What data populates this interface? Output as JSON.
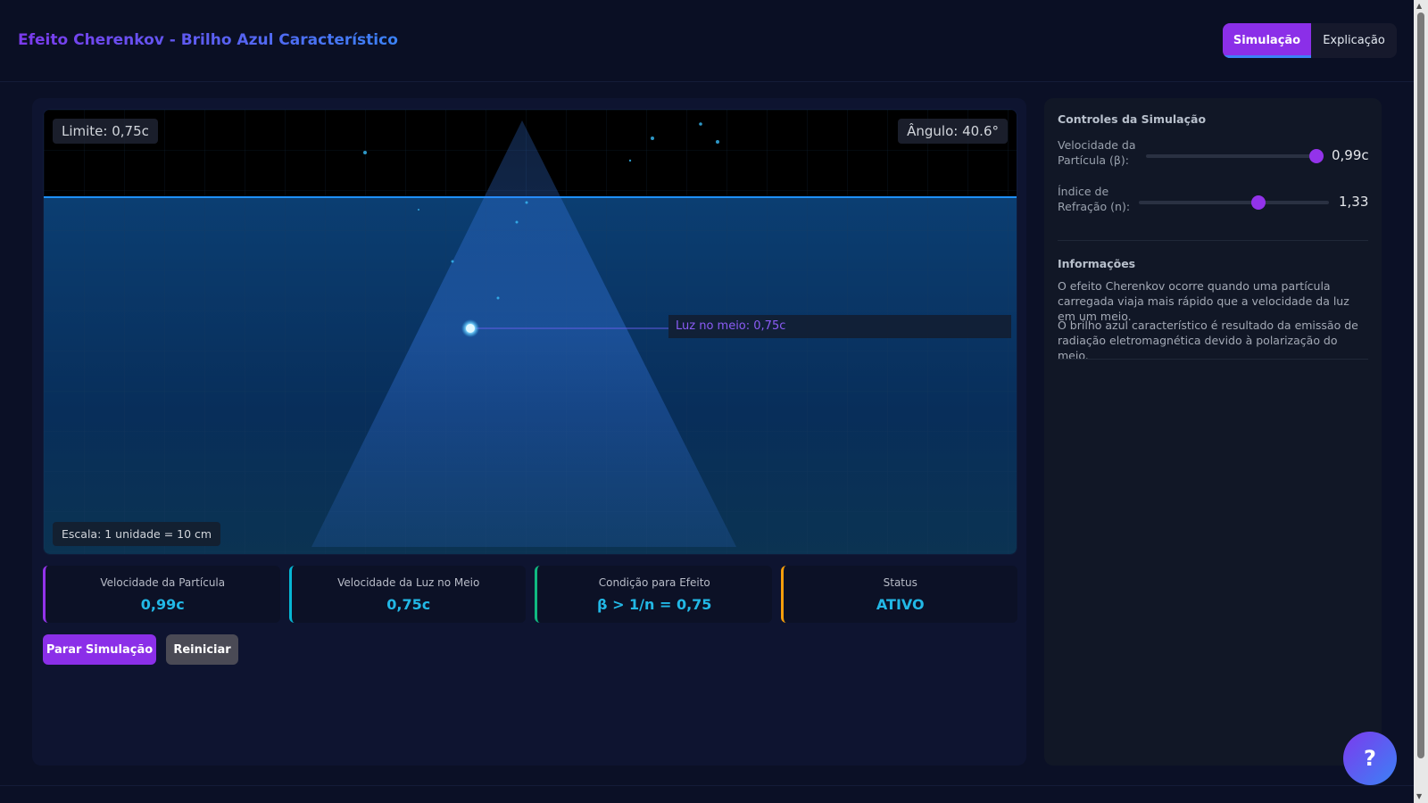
{
  "header": {
    "title": "Efeito Cherenkov - Brilho Azul Característico",
    "tabs": [
      {
        "label": "Simulação",
        "active": true
      },
      {
        "label": "Explicação",
        "active": false
      }
    ]
  },
  "canvas": {
    "limit_label": "Limite: 0,75c",
    "angle_label": "Ângulo: 40.6°",
    "light_label": "Luz no meio: 0,75c",
    "scale_label": "Escala: 1 unidade = 10 cm"
  },
  "stats": [
    {
      "label": "Velocidade da Partícula",
      "value": "0,99c",
      "color": "#9333ea"
    },
    {
      "label": "Velocidade da Luz no Meio",
      "value": "0,75c",
      "color": "#06b6d4"
    },
    {
      "label": "Condição para Efeito",
      "value": "β > 1/n = 0,75",
      "color": "#10b981"
    },
    {
      "label": "Status",
      "value": "ATIVO",
      "color": "#f59e0b"
    }
  ],
  "buttons": {
    "stop": "Parar Simulação",
    "reset": "Reiniciar"
  },
  "controls": {
    "title": "Controles da Simulação",
    "velocity": {
      "label": "Velocidade da Partícula (β):",
      "value": "0,99c",
      "fraction": 0.99
    },
    "refraction": {
      "label": "Índice de Refração (n):",
      "value": "1,33",
      "fraction": 0.63
    }
  },
  "info": {
    "title": "Informações",
    "paragraphs": [
      "O efeito Cherenkov ocorre quando uma partícula carregada viaja mais rápido que a velocidade da luz em um meio.",
      "O brilho azul característico é resultado da emissão de radiação eletromagnética devido à polarização do meio."
    ]
  },
  "help": {
    "label": "?"
  },
  "colors": {
    "accent": "#8b2fe8",
    "highlight": "#22b8e6",
    "water": "#0a3a6e"
  }
}
